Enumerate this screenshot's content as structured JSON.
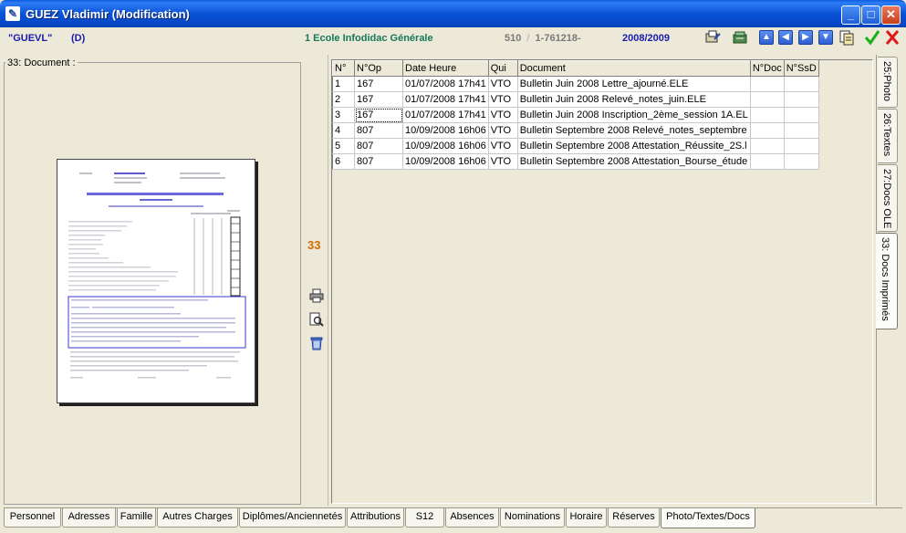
{
  "window": {
    "title": "GUEZ Vladimir (Modification)",
    "app_icon": "app-icon"
  },
  "header": {
    "code": "\"GUEVL\"",
    "status": "(D)",
    "school": "1 Ecole Infodidac Générale",
    "number_part1": "510",
    "number_sep": "/",
    "number_part2": "1-761218-",
    "year": "2008/2009"
  },
  "toolbar": {
    "icons": [
      "edit-doc-icon",
      "archive-icon",
      "arrow-up-icon",
      "arrow-left-icon",
      "arrow-right-icon",
      "arrow-down-icon",
      "copy-icon",
      "validate-check-icon",
      "cancel-x-icon"
    ]
  },
  "left_panel": {
    "label": "33: Document :"
  },
  "middle": {
    "count": "33",
    "icons": [
      "print-icon",
      "preview-icon",
      "delete-icon"
    ]
  },
  "grid": {
    "columns": [
      "N°",
      "N°Op",
      "Date Heure",
      "Qui",
      "Document",
      "N°Doc",
      "N°SsD"
    ],
    "rows": [
      {
        "n": "1",
        "op": "167",
        "date": "01/07/2008 17h41",
        "qui": "VTO",
        "doc": "Bulletin Juin 2008 Lettre_ajourné.ELE",
        "ndoc": "",
        "nssd": ""
      },
      {
        "n": "2",
        "op": "167",
        "date": "01/07/2008 17h41",
        "qui": "VTO",
        "doc": "Bulletin Juin 2008 Relevé_notes_juin.ELE",
        "ndoc": "",
        "nssd": ""
      },
      {
        "n": "3",
        "op": "167",
        "date": "01/07/2008 17h41",
        "qui": "VTO",
        "doc": "Bulletin Juin 2008 Inscription_2ème_session 1A.EL",
        "ndoc": "",
        "nssd": ""
      },
      {
        "n": "4",
        "op": "807",
        "date": "10/09/2008 16h06",
        "qui": "VTO",
        "doc": "Bulletin Septembre 2008 Relevé_notes_septembre",
        "ndoc": "",
        "nssd": ""
      },
      {
        "n": "5",
        "op": "807",
        "date": "10/09/2008 16h06",
        "qui": "VTO",
        "doc": "Bulletin Septembre 2008 Attestation_Réussite_2S.l",
        "ndoc": "",
        "nssd": ""
      },
      {
        "n": "6",
        "op": "807",
        "date": "10/09/2008 16h06",
        "qui": "VTO",
        "doc": "Bulletin Septembre 2008 Attestation_Bourse_étude",
        "ndoc": "",
        "nssd": ""
      }
    ],
    "selected_row": 3
  },
  "right_tabs": [
    "25:Photo",
    "26:Textes",
    "27:Docs OLE",
    "33: Docs Imprimés"
  ],
  "right_tab_active": "33: Docs Imprimés",
  "bottom_tabs": [
    "Personnel",
    "Adresses",
    "Famille",
    "Autres Charges",
    "Diplômes/Anciennetés",
    "Attributions",
    "S12",
    "Absences",
    "Nominations",
    "Horaire",
    "Réserves",
    "Photo/Textes/Docs"
  ],
  "bottom_tab_active": "Photo/Textes/Docs",
  "colors": {
    "titlebar": "#0a53d8",
    "header_blue": "#1a1ab0",
    "school_green": "#17785b",
    "count_orange": "#d46b00",
    "window_bg": "#ece9d8"
  }
}
